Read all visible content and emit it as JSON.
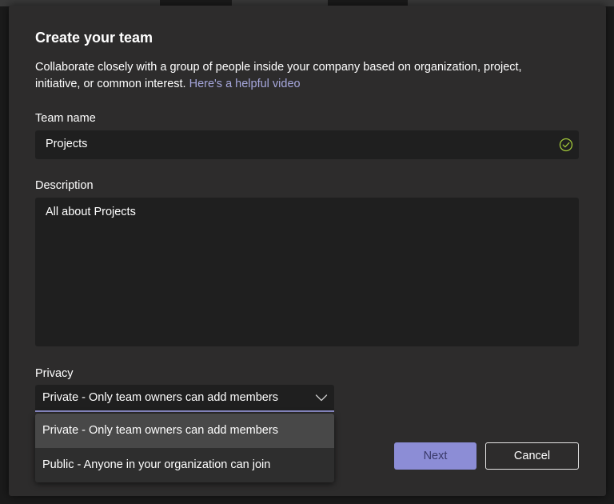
{
  "dialog": {
    "title": "Create your team",
    "subtitle": "Collaborate closely with a group of people inside your company based on organization, project, initiative, or common interest.",
    "help_link": "Here's a helpful video"
  },
  "team_name": {
    "label": "Team name",
    "value": "Projects",
    "valid_icon": "check-circle-icon",
    "valid_color": "#a3c93a"
  },
  "description": {
    "label": "Description",
    "value": "All about Projects"
  },
  "privacy": {
    "label": "Privacy",
    "selected": "Private - Only team owners can add members",
    "options": [
      "Private - Only team owners can add members",
      "Public - Anyone in your organization can join"
    ]
  },
  "actions": {
    "next_label": "Next",
    "cancel_label": "Cancel"
  },
  "colors": {
    "accent": "#8c8dd6",
    "link": "#a6a7dc",
    "dialog_bg": "#2d2c2c",
    "input_bg": "#1f1f1f"
  }
}
